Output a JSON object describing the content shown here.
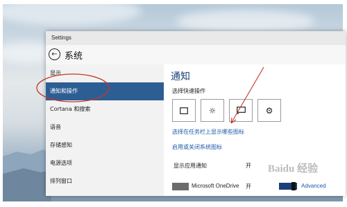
{
  "window": {
    "title": "Settings"
  },
  "header": {
    "back_icon": "back-arrow-icon",
    "title": "系统"
  },
  "sidebar": {
    "items": [
      {
        "label": "显示",
        "active": false
      },
      {
        "label": "通知和操作",
        "active": true
      },
      {
        "label": "Cortana 和搜索",
        "active": false
      },
      {
        "label": "语音",
        "active": false
      },
      {
        "label": "存储感知",
        "active": false
      },
      {
        "label": "电源选项",
        "active": false
      },
      {
        "label": "排列窗口",
        "active": false
      }
    ]
  },
  "content": {
    "section_title": "通知",
    "quick_actions_heading": "选择快速操作",
    "quick_actions": [
      {
        "icon": "tablet-mode-icon"
      },
      {
        "icon": "brightness-icon"
      },
      {
        "icon": "connect-icon"
      },
      {
        "icon": "settings-gear-icon"
      }
    ],
    "link_taskbar_icons": "选择在任务栏上显示哪些图标",
    "link_system_icons": "启用或关闭系统图标",
    "app_notifications": {
      "label": "显示应用通知",
      "state": "开"
    },
    "apps": [
      {
        "name": "Microsoft OneDrive",
        "state": "开",
        "advanced_label": "Advanced"
      }
    ]
  },
  "watermark_text": "Baidu 经验",
  "colors": {
    "accent": "#2d5e93",
    "title_blue": "#1a3f79",
    "link_blue": "#1a5aa8",
    "annotation_red": "#c0392b"
  }
}
